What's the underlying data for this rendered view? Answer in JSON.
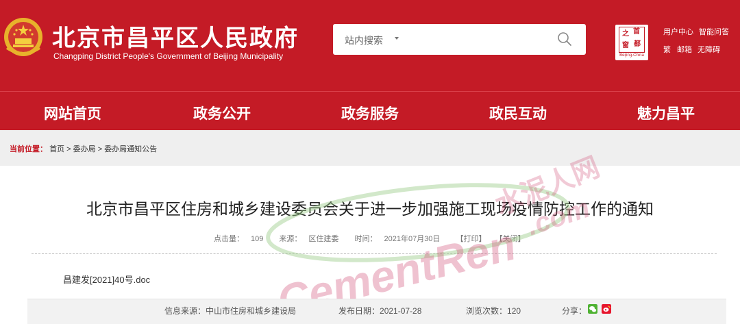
{
  "header": {
    "title": "北京市昌平区人民政府",
    "subtitle": "Changping District People's Government of Beijing Municipality",
    "search_scope": "站内搜索",
    "search_value": "",
    "capital_logo": {
      "chars": [
        "之",
        "首",
        "窗",
        "都"
      ],
      "caption": "Beijing-China"
    },
    "links": {
      "user_center": "用户中心",
      "smart_qa": "智能问答",
      "traditional": "繁",
      "mailbox": "邮箱",
      "accessibility": "无障碍"
    }
  },
  "nav": {
    "items": [
      "网站首页",
      "政务公开",
      "政务服务",
      "政民互动",
      "魅力昌平"
    ]
  },
  "breadcrumb": {
    "label": "当前位置：",
    "items": [
      "首页",
      "委办局",
      "委办局通知公告"
    ],
    "separator": ">"
  },
  "article": {
    "title": "北京市昌平区住房和城乡建设委员会关于进一步加强施工现场疫情防控工作的通知",
    "meta": {
      "views_label": "点击量：",
      "views": "109",
      "source_label": "来源：",
      "source": "区住建委",
      "time_label": "时间：",
      "time": "2021年07月30日",
      "print": "【打印】",
      "close": "【关闭】"
    },
    "attachment": "昌建发[2021]40号.doc"
  },
  "source_bar": {
    "source_label": "信息来源：",
    "source": "中山市住房和城乡建设局",
    "date_label": "发布日期：",
    "date": "2021-07-28",
    "views_label": "浏览次数：",
    "views": "120",
    "share_label": "分享："
  },
  "watermark": {
    "text": "CementRen",
    "domain": ".com",
    "cn": "水泥人网"
  },
  "colors": {
    "brand": "#c41b26",
    "breadcrumb_bg": "#efefef",
    "watermark_pink": "#d4547b"
  }
}
